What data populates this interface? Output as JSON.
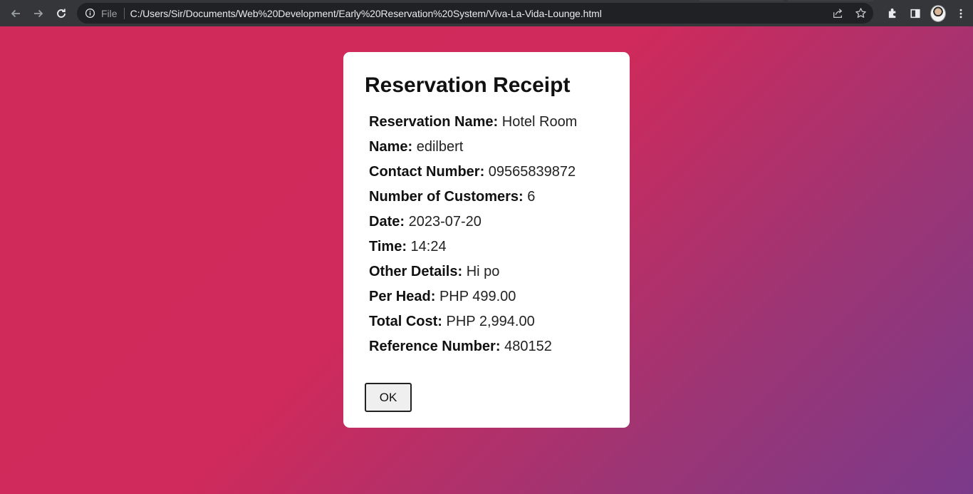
{
  "browser": {
    "file_label": "File",
    "url": "C:/Users/Sir/Documents/Web%20Development/Early%20Reservation%20System/Viva-La-Vida-Lounge.html"
  },
  "icons": {
    "back": "arrow-left-icon",
    "forward": "arrow-right-icon",
    "reload": "reload-icon",
    "info": "info-icon",
    "share": "share-icon",
    "bookmark": "star-icon",
    "extensions": "puzzle-icon",
    "side_panel": "side-panel-icon",
    "menu": "kebab-menu-icon"
  },
  "colors": {
    "gradient_start": "#d02a5a",
    "gradient_end": "#7a3a8a",
    "card_bg": "#ffffff"
  },
  "receipt": {
    "title": "Reservation Receipt",
    "fields": [
      {
        "label": "Reservation Name:",
        "value": "Hotel Room"
      },
      {
        "label": "Name:",
        "value": "edilbert"
      },
      {
        "label": "Contact Number:",
        "value": "09565839872"
      },
      {
        "label": "Number of Customers:",
        "value": "6"
      },
      {
        "label": "Date:",
        "value": "2023-07-20"
      },
      {
        "label": "Time:",
        "value": "14:24"
      },
      {
        "label": "Other Details:",
        "value": "Hi po"
      },
      {
        "label": "Per Head:",
        "value": "PHP 499.00"
      },
      {
        "label": "Total Cost:",
        "value": "PHP 2,994.00"
      },
      {
        "label": "Reference Number:",
        "value": "480152"
      }
    ],
    "ok_label": "OK"
  }
}
